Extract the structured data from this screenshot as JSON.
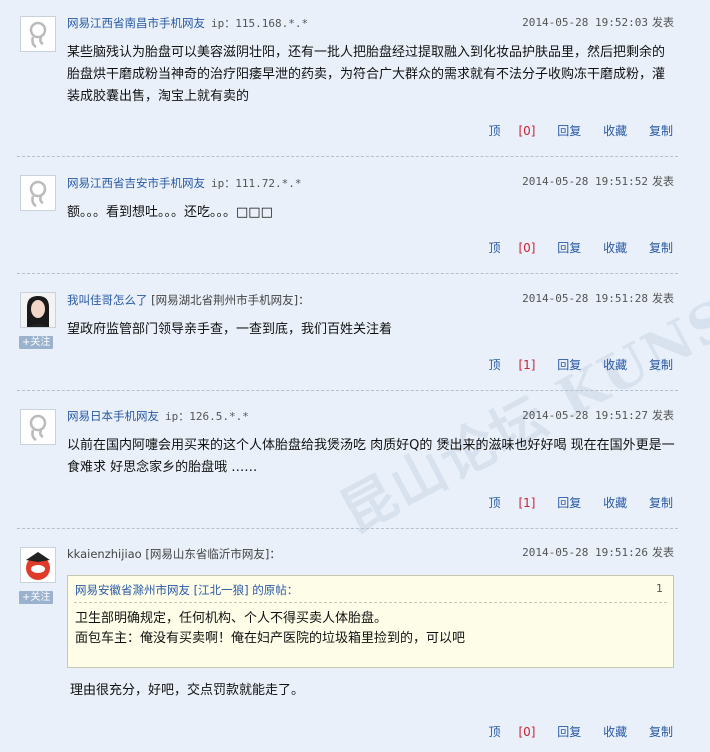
{
  "posts": [
    {
      "user": "网易江西省南昌市手机网友",
      "ip": "ip：115.168.*.*",
      "time": "2014-05-28 19:52:03",
      "time_label": "发表",
      "content": "某些脑残认为胎盘可以美容滋阴壮阳，还有一批人把胎盘经过提取融入到化妆品护肤品里，然后把剩余的胎盘烘干磨成粉当神奇的治疗阳痿早泄的药卖，为符合广大群众的需求就有不法分子收购冻干磨成粉，灌装成胶囊出售，淘宝上就有卖的",
      "up_label": "顶",
      "up_count": "[0]",
      "reply_label": "回复",
      "fav_label": "收藏",
      "copy_label": "复制"
    },
    {
      "user": "网易江西省吉安市手机网友",
      "ip": "ip：111.72.*.*",
      "time": "2014-05-28 19:51:52",
      "time_label": "发表",
      "content": "额。。。看到想吐。。。还吃。。。□□□",
      "up_label": "顶",
      "up_count": "[0]",
      "reply_label": "回复",
      "fav_label": "收藏",
      "copy_label": "复制"
    },
    {
      "user": "我叫佳哥怎么了",
      "location": "[网易湖北省荆州市手机网友]：",
      "follow": "+关注",
      "time": "2014-05-28 19:51:28",
      "time_label": "发表",
      "content": "望政府监管部门领导亲手查，一查到底，我们百姓关注着",
      "up_label": "顶",
      "up_count": "[1]",
      "reply_label": "回复",
      "fav_label": "收藏",
      "copy_label": "复制"
    },
    {
      "user": "网易日本手机网友",
      "ip": "ip：126.5.*.*",
      "time": "2014-05-28 19:51:27",
      "time_label": "发表",
      "content": "以前在国内阿嚏会用买来的这个人体胎盘给我煲汤吃 肉质好Q的 煲出来的滋味也好好喝 现在在国外更是一食难求 好思念家乡的胎盘哦 ……",
      "up_label": "顶",
      "up_count": "[1]",
      "reply_label": "回复",
      "fav_label": "收藏",
      "copy_label": "复制"
    },
    {
      "user": "kkaienzhijiao",
      "location": "[网易山东省临沂市网友]：",
      "follow": "+关注",
      "time": "2014-05-28 19:51:26",
      "time_label": "发表",
      "quote_head": "网易安徽省滁州市网友 [江北一狼] 的原帖：",
      "quote_num": "1",
      "quote_line1": "卫生部明确规定，任何机构、个人不得买卖人体胎盘。",
      "quote_line2": "面包车主：俺没有买卖啊！俺在妇产医院的垃圾箱里捡到的，可以吧",
      "content": "理由很充分，好吧，交点罚款就能走了。",
      "up_label": "顶",
      "up_count": "[0]",
      "reply_label": "回复",
      "fav_label": "收藏",
      "copy_label": "复制"
    }
  ],
  "watermark": "昆山论坛 KUNSHAN BBS"
}
